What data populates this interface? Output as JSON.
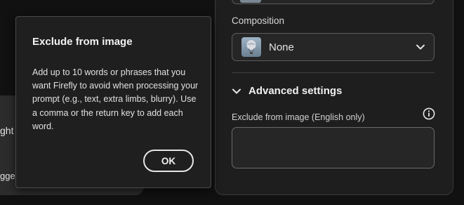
{
  "left_panel": {
    "fragment_1": "ght",
    "fragment_2": "gges"
  },
  "popover": {
    "title": "Exclude from image",
    "body": "Add up to 10 words or phrases that you want Firefly to avoid when processing your prompt (e.g., text, extra limbs, blurry). Use a comma or the return key to add each word.",
    "ok_label": "OK"
  },
  "settings": {
    "composition_label": "Composition",
    "composition_value": "None",
    "composition_thumb_icon": "hot-air-balloon-thumbnail",
    "advanced_label": "Advanced settings",
    "advanced_icon": "chevron-down-icon",
    "exclude_label": "Exclude from image (English only)",
    "exclude_value": "",
    "info_icon": "info-icon"
  },
  "colors": {
    "background": "#111111",
    "panel": "#1e1e1e",
    "field": "#262626",
    "text": "#e8e8e8"
  }
}
